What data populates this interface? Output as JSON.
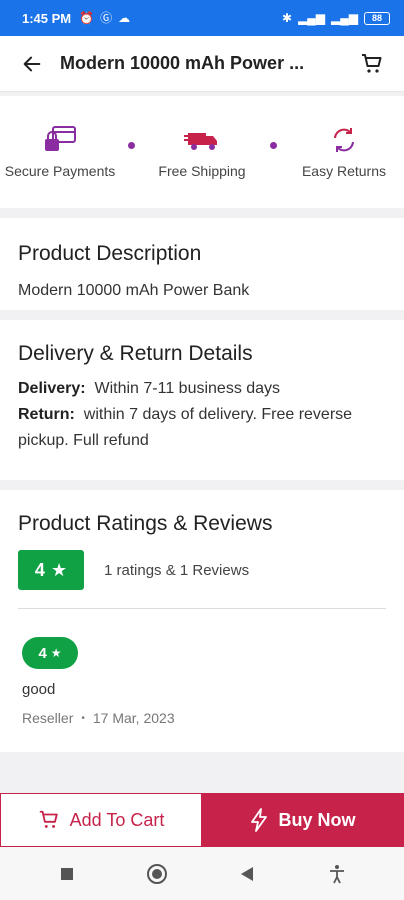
{
  "status_bar": {
    "time": "1:45 PM",
    "battery": "88"
  },
  "header": {
    "title": "Modern 10000 mAh Power ..."
  },
  "features": [
    {
      "label": "Secure Payments",
      "icon": "secure-payment-icon"
    },
    {
      "label": "Free Shipping",
      "icon": "truck-icon"
    },
    {
      "label": "Easy Returns",
      "icon": "returns-icon"
    }
  ],
  "description": {
    "title": "Product Description",
    "text": "Modern 10000 mAh Power Bank"
  },
  "delivery": {
    "title": "Delivery & Return Details",
    "delivery_label": "Delivery:",
    "delivery_value": "Within 7-11 business days",
    "return_label": "Return:",
    "return_value": "within 7 days of delivery. Free reverse pickup. Full refund"
  },
  "ratings": {
    "title": "Product Ratings & Reviews",
    "average": "4",
    "summary": "1 ratings & 1 Reviews",
    "review": {
      "rating": "4",
      "text": "good",
      "author": "Reseller",
      "separator": "•",
      "date": "17 Mar, 2023"
    }
  },
  "actions": {
    "add_to_cart": "Add To Cart",
    "buy_now": "Buy Now"
  },
  "colors": {
    "status_bar": "#1a73e8",
    "accent": "#c7234a",
    "rating_green": "#11a145",
    "feature_purple": "#8a2da0"
  }
}
